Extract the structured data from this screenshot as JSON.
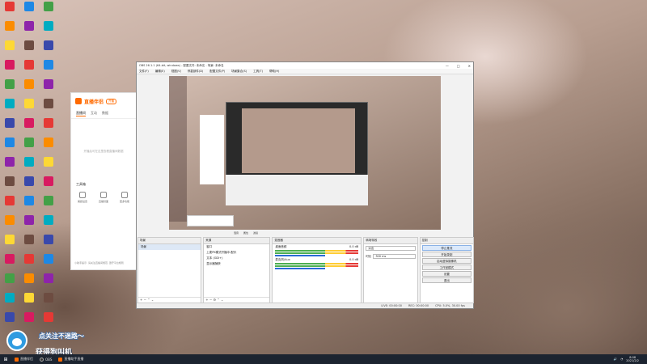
{
  "obs": {
    "window_title": "OBS 26.1.1 (64-bit, windows) - 配置文件: 未命名 - 场景: 未命名",
    "menu": [
      "文件(F)",
      "编辑(E)",
      "视图(V)",
      "停靠部件(D)",
      "配置文件(P)",
      "场景集合(S)",
      "工具(T)",
      "帮助(H)"
    ],
    "preview_bar": {
      "audio": "混音",
      "properties": "属性",
      "filters": "滤镜"
    },
    "scenes": {
      "title": "场景",
      "items": [
        "场景"
      ]
    },
    "sources": {
      "title": "来源",
      "items": [
        "窗口",
        "上麦PK模式开播中-配乐",
        "文本 (GDI+)",
        "显示器捕获"
      ]
    },
    "mixer": {
      "title": "混音器",
      "channels": [
        {
          "name": "桌面音频",
          "db": "0.0 dB"
        },
        {
          "name": "麦克风/Aux",
          "db": "0.0 dB"
        }
      ]
    },
    "transitions": {
      "title": "转场特效",
      "type": "淡出",
      "duration_label": "时长",
      "duration": "300 ms"
    },
    "controls": {
      "title": "控制",
      "buttons": [
        "停止推流",
        "开始录制",
        "启动虚拟摄像机",
        "工作室模式",
        "设置",
        "退出"
      ]
    },
    "status": {
      "live": "LIVE: 00:00:00",
      "rec": "REC: 00:00:00",
      "cpu": "CPU: 5.0%, 30.00 fps"
    }
  },
  "zbj": {
    "title": "直播伴侣",
    "badge": "开播",
    "tabs": [
      "直播间",
      "互动",
      "数据"
    ],
    "empty_text": "开播后可在这里查看直播间数据",
    "tools_title": "工具箱",
    "tools": [
      "美颜设置",
      "直播封面",
      "更多功能"
    ],
    "footer": "小助手提示: 请关注直播间规范, 遵守平台规则"
  },
  "sticker": {
    "line1": "点关注不迷路～",
    "line2": "获得狗叫机"
  },
  "taskbar": {
    "apps": [
      "直播伴侣",
      "OBS",
      "直播助手直播"
    ],
    "time": "8:08",
    "date": "2021/2/2"
  },
  "colors": {
    "accent": "#ff6a00",
    "obs_selection": "#dde8f6",
    "taskbar": "#1c2430"
  }
}
